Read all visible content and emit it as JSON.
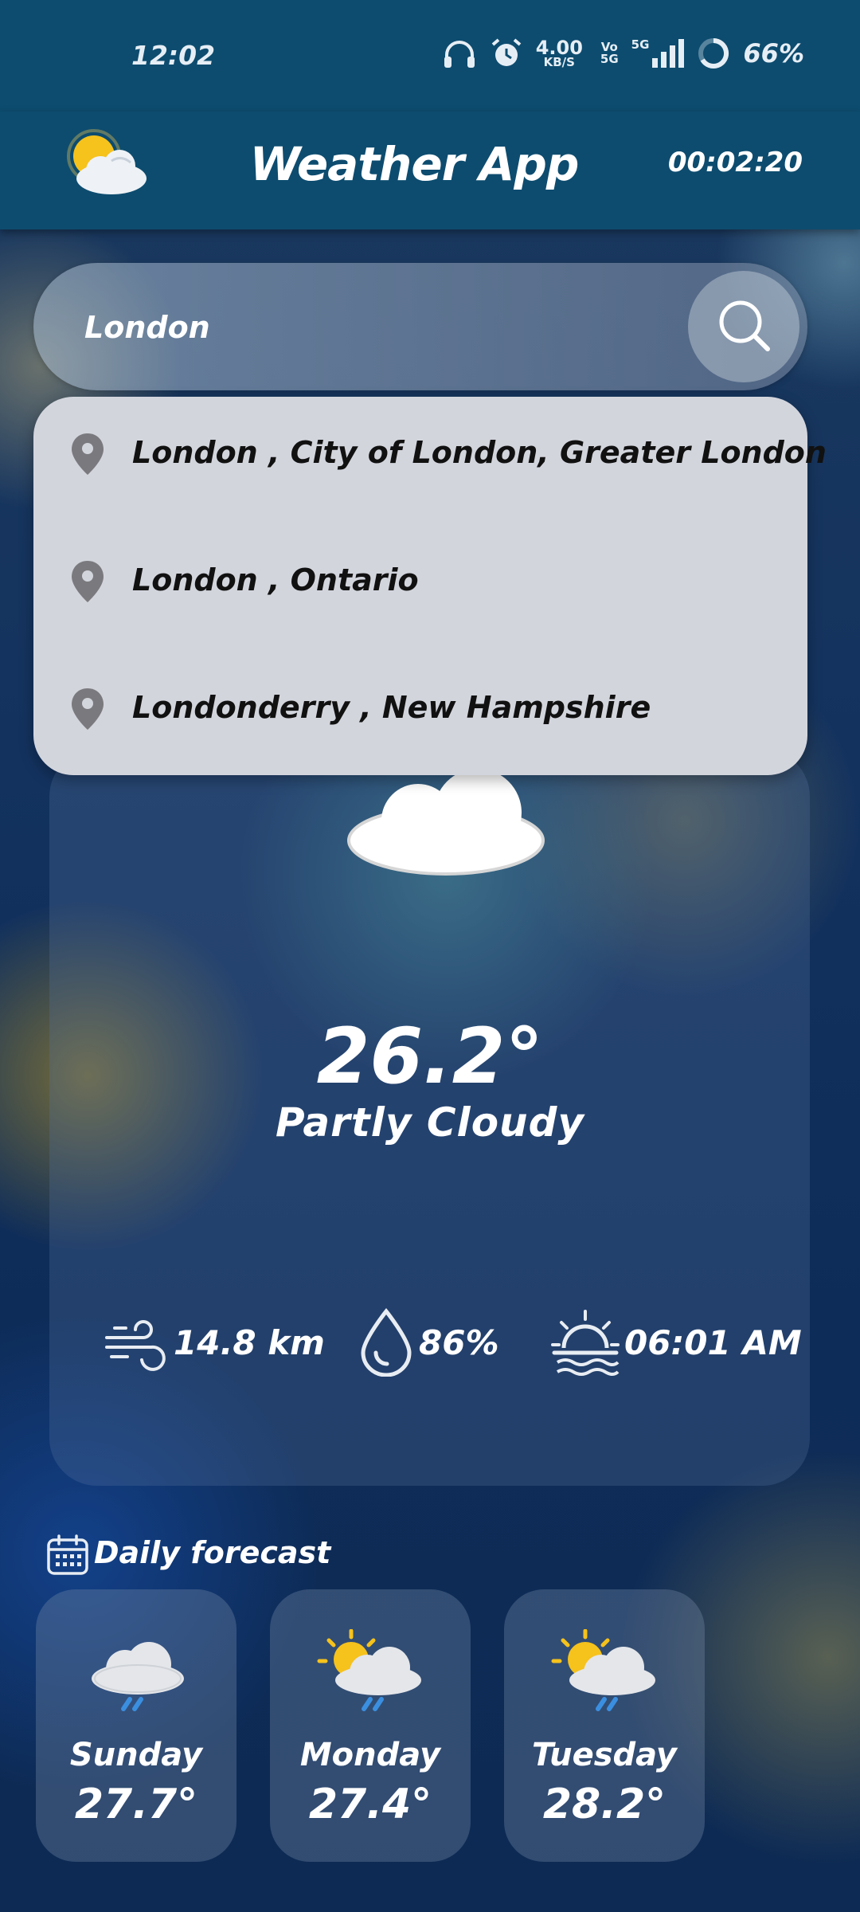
{
  "status_bar": {
    "time": "12:02",
    "net_speed_value": "4.00",
    "net_speed_unit": "KB/S",
    "volte_top": "Vo",
    "volte_bottom": "5G",
    "network": "5G",
    "battery": "66%"
  },
  "app_bar": {
    "title": "Weather App",
    "timer": "00:02:20",
    "logo_icon": "sun-cloud-icon"
  },
  "search": {
    "value": "London",
    "button_icon": "search-icon"
  },
  "suggestions": [
    {
      "label": "London , City of London, Greater London",
      "icon": "location-pin-icon"
    },
    {
      "label": "London , Ontario",
      "icon": "location-pin-icon"
    },
    {
      "label": "Londonderry , New Hampshire",
      "icon": "location-pin-icon"
    }
  ],
  "current": {
    "temperature": "26.2°",
    "condition": "Partly Cloudy",
    "wind": "14.8 km",
    "humidity": "86%",
    "sunrise": "06:01 AM"
  },
  "forecast": {
    "title": "Daily forecast",
    "days": [
      {
        "day": "Sunday",
        "temp": "27.7°",
        "icon": "rain-cloud-icon"
      },
      {
        "day": "Monday",
        "temp": "27.4°",
        "icon": "sun-rain-cloud-icon"
      },
      {
        "day": "Tuesday",
        "temp": "28.2°",
        "icon": "sun-rain-cloud-icon"
      }
    ]
  },
  "colors": {
    "header": "#0d4c6f",
    "dropdown": "#d3d5dd",
    "accent_rain": "#3b8fe0",
    "sun": "#f6c21c"
  }
}
